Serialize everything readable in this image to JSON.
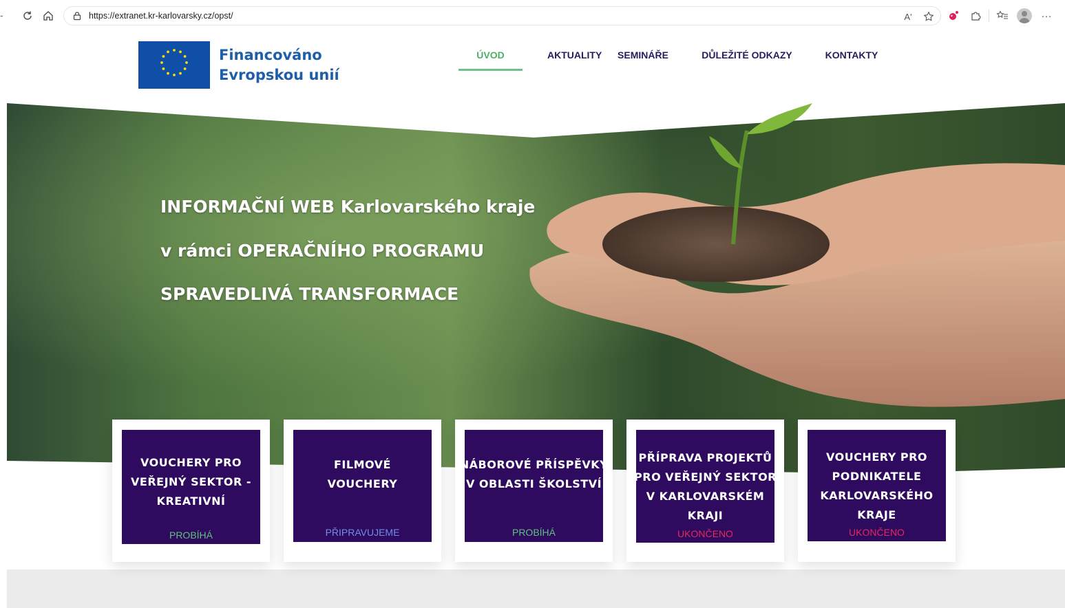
{
  "browser": {
    "url": "https://extranet.kr-karlovarsky.cz/opst/",
    "icons": {
      "back": "refresh-icon",
      "home": "home-icon",
      "lock": "lock-icon",
      "read_aloud": "read-aloud-icon",
      "favorite": "star-icon",
      "extension": "extension-icon",
      "extensions": "puzzle-icon",
      "favorites": "favorites-bar-icon",
      "profile": "profile-avatar",
      "more": "more-icon"
    },
    "read_aloud_label": "Aʹ",
    "more_label": "···"
  },
  "header": {
    "eu_line1": "Financováno",
    "eu_line2": "Evropskou unií",
    "nav": [
      {
        "label": "ÚVOD",
        "active": true
      },
      {
        "label": "AKTUALITY",
        "active": false
      },
      {
        "label": "SEMINÁŘE",
        "active": false
      },
      {
        "label": "DŮLEŽITÉ ODKAZY",
        "active": false
      },
      {
        "label": "KONTAKTY",
        "active": false
      }
    ]
  },
  "hero": {
    "line1": "INFORMAČNÍ WEB Karlovarského kraje",
    "line2": "v rámci OPERAČNÍHO PROGRAMU",
    "line3": "SPRAVEDLIVÁ TRANSFORMACE"
  },
  "cards": [
    {
      "title_lines": [
        "VOUCHERY PRO",
        "VEŘEJNÝ SEKTOR -",
        "KREATIVNÍ"
      ],
      "status": "PROBÍHÁ",
      "status_color": "#5fc27e"
    },
    {
      "title_lines": [
        "FILMOVÉ",
        "VOUCHERY"
      ],
      "status": "PŘIPRAVUJEME",
      "status_color": "#6f8fe8"
    },
    {
      "title_lines": [
        "NÁBOROVÉ PŘÍSPĚVKY",
        "V OBLASTI ŠKOLSTVÍ"
      ],
      "status": "PROBÍHÁ",
      "status_color": "#5fc27e"
    },
    {
      "title_lines": [
        "PŘÍPRAVA PROJEKTŮ",
        "PRO VEŘEJNÝ SEKTOR",
        "V KARLOVARSKÉM",
        "KRAJI"
      ],
      "status": "UKONČENO",
      "status_color": "#e8285a"
    },
    {
      "title_lines": [
        "VOUCHERY PRO",
        "PODNIKATELE",
        "KARLOVARSKÉHO",
        "KRAJE"
      ],
      "status": "UKONČENO",
      "status_color": "#e8285a"
    }
  ],
  "colors": {
    "card_bg": "#2e0b5e",
    "nav_text": "#2a1a5e",
    "nav_active": "#4caf6a",
    "eu_blue": "#0f4fa8",
    "eu_yellow": "#ffdd00"
  }
}
